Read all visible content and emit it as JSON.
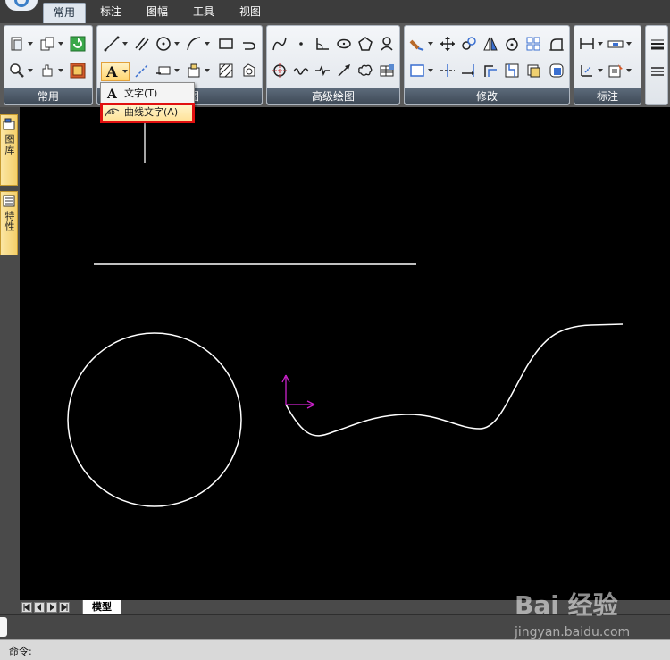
{
  "tabs": [
    {
      "label": "常用",
      "active": true
    },
    {
      "label": "标注",
      "active": false
    },
    {
      "label": "图幅",
      "active": false
    },
    {
      "label": "工具",
      "active": false
    },
    {
      "label": "视图",
      "active": false
    }
  ],
  "ribbon_groups": [
    {
      "caption": "常用"
    },
    {
      "caption": "图"
    },
    {
      "caption": "高级绘图"
    },
    {
      "caption": "修改"
    },
    {
      "caption": "标注"
    }
  ],
  "text_menu": {
    "items": [
      {
        "label": "文字(T)",
        "icon": "text-a-icon",
        "highlighted": false
      },
      {
        "label": "曲线文字(A)",
        "icon": "curve-text-icon",
        "highlighted": true
      }
    ]
  },
  "side_panels": [
    {
      "label": "图库",
      "icon": "library-icon"
    },
    {
      "label": "特性",
      "icon": "properties-icon"
    }
  ],
  "layout_tabs": {
    "model_label": "模型"
  },
  "command": {
    "prompt": "命令:"
  },
  "watermark": {
    "logo": "Bai 经验",
    "url": "jingyan.baidu.com"
  },
  "colors": {
    "canvas_bg": "#000000",
    "entity": "#ffffff",
    "ucs": "#cc22cc",
    "highlight_frame": "#e11010"
  }
}
